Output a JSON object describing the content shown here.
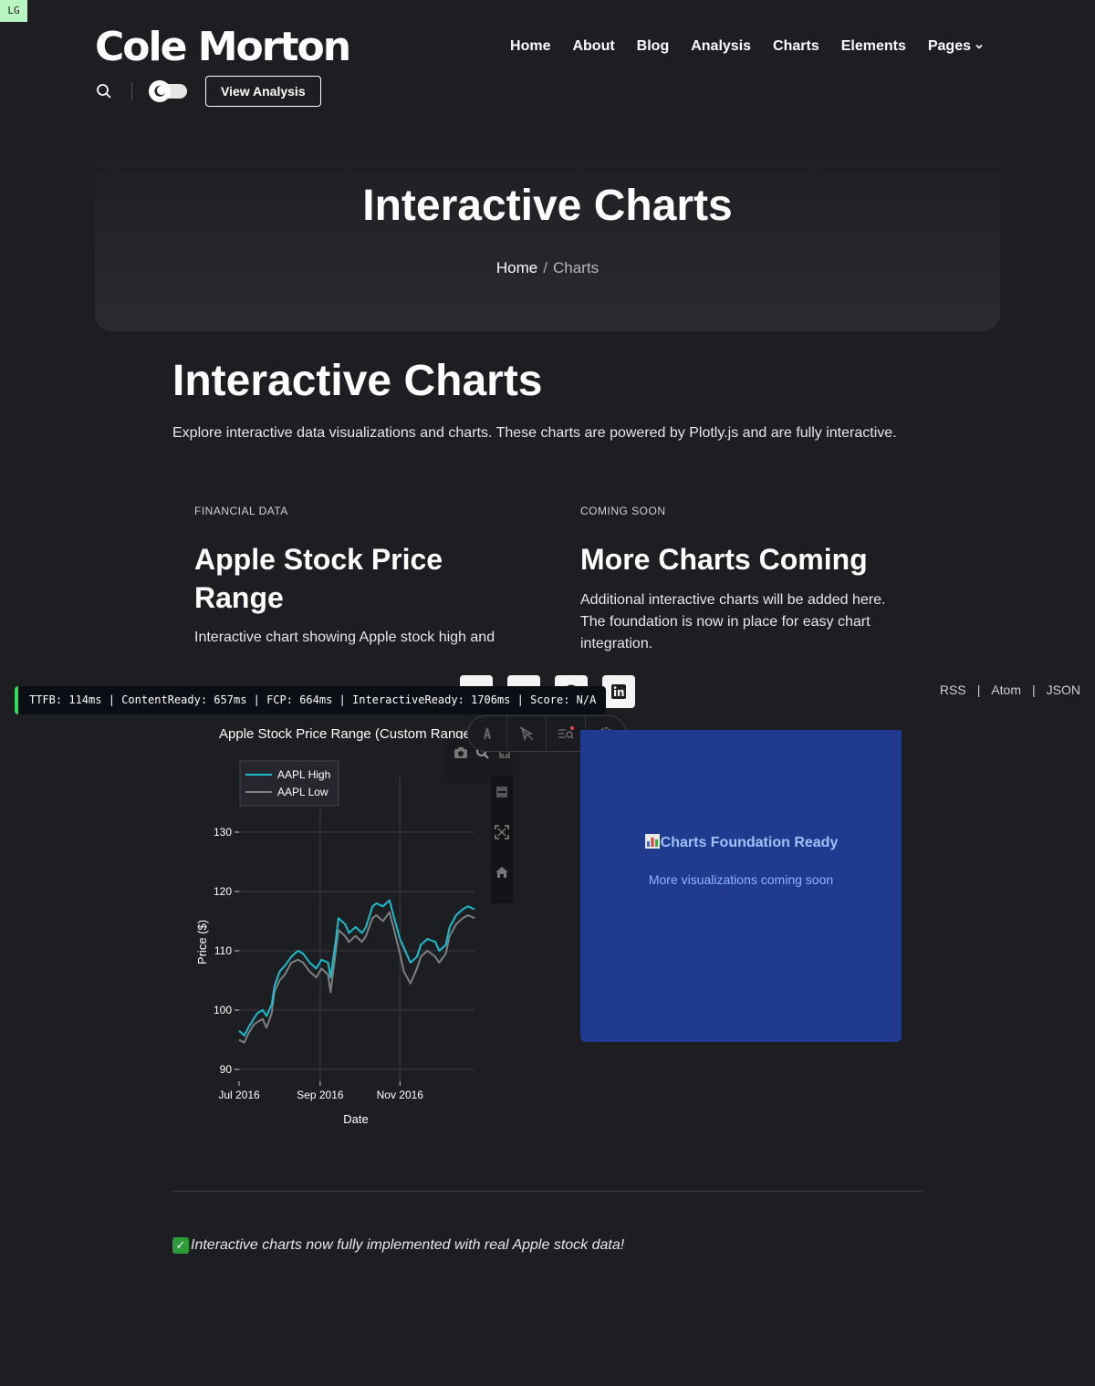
{
  "badge": "LG",
  "site": {
    "logo": "Cole Morton"
  },
  "nav": {
    "items": [
      "Home",
      "About",
      "Blog",
      "Analysis",
      "Charts",
      "Elements",
      "Pages"
    ]
  },
  "toolbar": {
    "view_analysis": "View Analysis"
  },
  "hero": {
    "title": "Interactive Charts",
    "breadcrumb_home": "Home",
    "breadcrumb_sep": "/",
    "breadcrumb_current": "Charts"
  },
  "main": {
    "title": "Interactive Charts",
    "intro": "Explore interactive data visualizations and charts. These charts are powered by Plotly.js and are fully interactive."
  },
  "cards": [
    {
      "eyebrow": "FINANCIAL DATA",
      "title": "Apple Stock Price Range",
      "desc": "Interactive chart showing Apple stock high and"
    },
    {
      "eyebrow": "COMING SOON",
      "title": "More Charts Coming",
      "desc": "Additional interactive charts will be added here. The foundation is now in place for easy chart integration."
    }
  ],
  "feeds": {
    "rss": "RSS",
    "atom": "Atom",
    "json": "JSON",
    "sep": "|"
  },
  "perf": "TTFB: 114ms | ContentReady: 657ms | FCP: 664ms | InteractiveReady: 1706ms | Score: N/A",
  "placeholder": {
    "title": "Charts Foundation Ready",
    "subtitle": "More visualizations coming soon"
  },
  "footer_note": "Interactive charts now fully implemented with real Apple stock data!",
  "colors": {
    "high": "#17becf",
    "low": "#7f7f7f",
    "blue_box": "#1f3a8f"
  },
  "chart_data": {
    "type": "line",
    "title": "Apple Stock Price Range (Custom Range)",
    "xlabel": "Date",
    "ylabel": "Price ($)",
    "ylim": [
      88,
      138
    ],
    "x_tick_labels": [
      "Jul 2016",
      "Sep 2016",
      "Nov 2016"
    ],
    "y_tick_labels": [
      "90",
      "100",
      "110",
      "120",
      "130"
    ],
    "legend_position": "top-left",
    "grid": true,
    "x": [
      "2016-07-01",
      "2016-07-05",
      "2016-07-08",
      "2016-07-12",
      "2016-07-15",
      "2016-07-19",
      "2016-07-22",
      "2016-07-26",
      "2016-07-28",
      "2016-08-01",
      "2016-08-05",
      "2016-08-10",
      "2016-08-15",
      "2016-08-19",
      "2016-08-24",
      "2016-08-29",
      "2016-09-02",
      "2016-09-07",
      "2016-09-09",
      "2016-09-13",
      "2016-09-15",
      "2016-09-20",
      "2016-09-23",
      "2016-09-28",
      "2016-10-03",
      "2016-10-06",
      "2016-10-11",
      "2016-10-14",
      "2016-10-19",
      "2016-10-24",
      "2016-10-27",
      "2016-11-01",
      "2016-11-04",
      "2016-11-09",
      "2016-11-14",
      "2016-11-17",
      "2016-11-22",
      "2016-11-28",
      "2016-12-01",
      "2016-12-06",
      "2016-12-09",
      "2016-12-14",
      "2016-12-19",
      "2016-12-23",
      "2016-12-28"
    ],
    "series": [
      {
        "name": "AAPL High",
        "values": [
          96.5,
          95.7,
          97.0,
          98.5,
          99.5,
          100.0,
          99.0,
          101.0,
          104.0,
          106.5,
          107.5,
          109.0,
          110.0,
          109.5,
          108.0,
          107.0,
          108.5,
          108.0,
          105.5,
          112.0,
          115.5,
          114.5,
          113.0,
          114.0,
          113.0,
          114.0,
          117.5,
          118.0,
          117.5,
          118.5,
          116.0,
          112.0,
          110.5,
          108.0,
          109.0,
          111.0,
          112.0,
          111.5,
          110.0,
          111.0,
          114.0,
          116.0,
          117.0,
          117.5,
          117.0
        ]
      },
      {
        "name": "AAPL Low",
        "values": [
          95.0,
          94.5,
          96.0,
          97.5,
          98.0,
          98.5,
          97.0,
          99.5,
          103.0,
          105.0,
          106.0,
          108.0,
          108.5,
          108.0,
          106.5,
          105.5,
          107.0,
          106.0,
          103.0,
          110.0,
          113.5,
          112.5,
          111.5,
          112.5,
          111.5,
          112.5,
          115.5,
          116.0,
          115.0,
          116.5,
          114.0,
          109.5,
          106.5,
          104.5,
          107.0,
          109.0,
          110.0,
          109.0,
          108.0,
          109.5,
          112.5,
          114.5,
          115.5,
          116.0,
          115.5
        ]
      }
    ]
  }
}
